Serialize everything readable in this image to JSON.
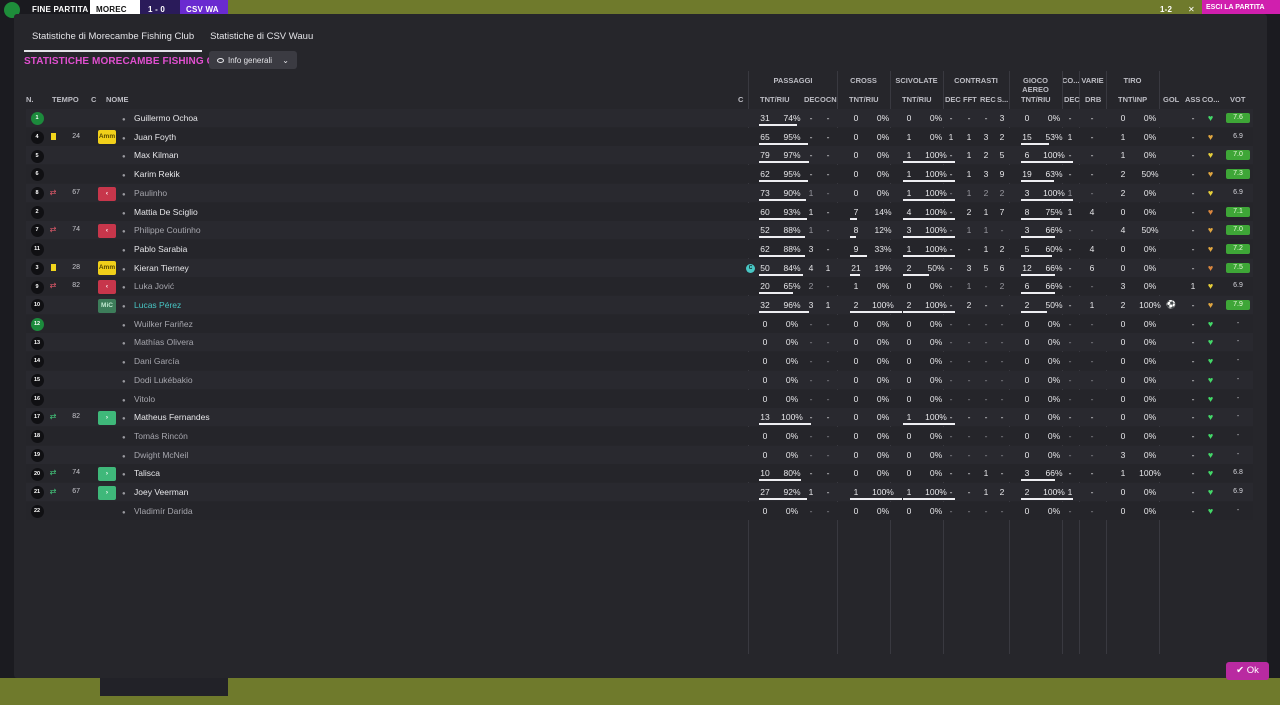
{
  "header_bar": {
    "labels": [
      "FINE PARTITA",
      "MOREC",
      "1 - 0",
      "CSV WA"
    ],
    "btn": "ESCI LA PARTITA",
    "score_mini": "1-2",
    "close_glyph": "✕"
  },
  "tabs": [
    {
      "label": "Statistiche di Morecambe Fishing Club",
      "active": true
    },
    {
      "label": "Statistiche di CSV Wauu",
      "active": false
    }
  ],
  "section_title": "STATISTICHE MORECAMBE FISHING CLUB",
  "dropdown_label": "Info generali",
  "group_headers": [
    "PASSAGGI",
    "CROSS",
    "SCIVOLATE",
    "CONTRASTI",
    "GIOCO AEREO",
    "CO...",
    "VARIE",
    "TIRO"
  ],
  "col_headers": {
    "num": "N.",
    "time": "TEMPO",
    "c": "C",
    "name": "NOME",
    "cap": "C",
    "pass_tnt": "TNT/RIU",
    "pass_dec": "DEC",
    "pass_ocn": "OCN",
    "cross_tnt": "TNT/RIU",
    "sciv_tnt": "TNT/RIU",
    "con_dec": "DEC",
    "con_fft": "FFT",
    "con_rec": "REC",
    "con_s": "S...",
    "aer_tnt": "TNT/RIU",
    "co_dec": "DEC",
    "drb": "DRB",
    "tiro": "TNT\\INP",
    "gol": "GOL",
    "ass": "ASS",
    "co2": "CO...",
    "vot": "VOT"
  },
  "ok_label": "Ok",
  "players": [
    {
      "n": "1",
      "gk": true,
      "ev": "",
      "min": "",
      "badge": "",
      "badge_type": "",
      "name": "Guillermo Ochoa",
      "style": "normal",
      "cap": false,
      "p": [
        "31",
        "74%"
      ],
      "p_bar": 0.74,
      "dec": "-",
      "ocn": "-",
      "cr": [
        "0",
        "0%"
      ],
      "cr_bar": 0,
      "sc": [
        "0",
        "0%"
      ],
      "sc_bar": 0,
      "ct": [
        "-",
        "-",
        "-",
        "3"
      ],
      "ae": [
        "0",
        "0%"
      ],
      "ae_bar": 0,
      "codec": "-",
      "drb": "-",
      "ti": [
        "0",
        "0%"
      ],
      "gol": "",
      "ass": "-",
      "heart": "#43d868",
      "vot": "7.6",
      "vot_g": true
    },
    {
      "n": "4",
      "gk": false,
      "ev": "yellow",
      "min": "24",
      "badge": "Amm",
      "badge_type": "amm",
      "name": "Juan Foyth",
      "style": "normal",
      "cap": false,
      "p": [
        "65",
        "95%"
      ],
      "p_bar": 0.95,
      "dec": "-",
      "ocn": "-",
      "cr": [
        "0",
        "0%"
      ],
      "cr_bar": 0,
      "sc": [
        "1",
        "0%"
      ],
      "sc_bar": 0,
      "ct": [
        "1",
        "1",
        "3",
        "2"
      ],
      "ae": [
        "15",
        "53%"
      ],
      "ae_bar": 0.53,
      "codec": "1",
      "drb": "-",
      "ti": [
        "1",
        "0%"
      ],
      "gol": "",
      "ass": "-",
      "heart": "#e0a640",
      "vot": "6.9",
      "vot_g": false
    },
    {
      "n": "5",
      "gk": false,
      "ev": "",
      "min": "",
      "badge": "",
      "badge_type": "",
      "name": "Max Kilman",
      "style": "normal",
      "cap": false,
      "p": [
        "79",
        "97%"
      ],
      "p_bar": 0.97,
      "dec": "-",
      "ocn": "-",
      "cr": [
        "0",
        "0%"
      ],
      "cr_bar": 0,
      "sc": [
        "1",
        "100%"
      ],
      "sc_bar": 1,
      "ct": [
        "-",
        "1",
        "2",
        "5"
      ],
      "ae": [
        "6",
        "100%"
      ],
      "ae_bar": 1,
      "codec": "-",
      "drb": "-",
      "ti": [
        "1",
        "0%"
      ],
      "gol": "",
      "ass": "-",
      "heart": "#e7cf3a",
      "vot": "7.0",
      "vot_g": true
    },
    {
      "n": "6",
      "gk": false,
      "ev": "",
      "min": "",
      "badge": "",
      "badge_type": "",
      "name": "Karim Rekik",
      "style": "normal",
      "cap": false,
      "p": [
        "62",
        "95%"
      ],
      "p_bar": 0.95,
      "dec": "-",
      "ocn": "-",
      "cr": [
        "0",
        "0%"
      ],
      "cr_bar": 0,
      "sc": [
        "1",
        "100%"
      ],
      "sc_bar": 1,
      "ct": [
        "-",
        "1",
        "3",
        "9"
      ],
      "ae": [
        "19",
        "63%"
      ],
      "ae_bar": 0.63,
      "codec": "-",
      "drb": "-",
      "ti": [
        "2",
        "50%"
      ],
      "gol": "",
      "ass": "-",
      "heart": "#e0a640",
      "vot": "7.3",
      "vot_g": true
    },
    {
      "n": "8",
      "gk": false,
      "ev": "out",
      "min": "67",
      "badge": "‹",
      "badge_type": "out",
      "name": "Paulinho",
      "style": "sub",
      "cap": false,
      "p": [
        "73",
        "90%"
      ],
      "p_bar": 0.9,
      "dec": "1",
      "ocn": "-",
      "cr": [
        "0",
        "0%"
      ],
      "cr_bar": 0,
      "sc": [
        "1",
        "100%"
      ],
      "sc_bar": 1,
      "ct": [
        "-",
        "1",
        "2",
        "2"
      ],
      "ae": [
        "3",
        "100%"
      ],
      "ae_bar": 1,
      "codec": "1",
      "drb": "-",
      "ti": [
        "2",
        "0%"
      ],
      "gol": "",
      "ass": "-",
      "heart": "#e7cf3a",
      "vot": "6.9",
      "vot_g": false
    },
    {
      "n": "2",
      "gk": false,
      "ev": "",
      "min": "",
      "badge": "",
      "badge_type": "",
      "name": "Mattia De Sciglio",
      "style": "normal",
      "cap": false,
      "p": [
        "60",
        "93%"
      ],
      "p_bar": 0.93,
      "dec": "1",
      "ocn": "-",
      "cr": [
        "7",
        "14%"
      ],
      "cr_bar": 0.14,
      "sc": [
        "4",
        "100%"
      ],
      "sc_bar": 1,
      "ct": [
        "-",
        "2",
        "1",
        "7"
      ],
      "ae": [
        "8",
        "75%"
      ],
      "ae_bar": 0.75,
      "codec": "1",
      "drb": "4",
      "ti": [
        "0",
        "0%"
      ],
      "gol": "",
      "ass": "-",
      "heart": "#d9863e",
      "vot": "7.1",
      "vot_g": true
    },
    {
      "n": "7",
      "gk": false,
      "ev": "out",
      "min": "74",
      "badge": "‹",
      "badge_type": "out",
      "name": "Philippe Coutinho",
      "style": "sub",
      "cap": false,
      "p": [
        "52",
        "88%"
      ],
      "p_bar": 0.88,
      "dec": "1",
      "ocn": "-",
      "cr": [
        "8",
        "12%"
      ],
      "cr_bar": 0.12,
      "sc": [
        "3",
        "100%"
      ],
      "sc_bar": 1,
      "ct": [
        "-",
        "1",
        "1",
        "-"
      ],
      "ae": [
        "3",
        "66%"
      ],
      "ae_bar": 0.66,
      "codec": "-",
      "drb": "-",
      "ti": [
        "4",
        "50%"
      ],
      "gol": "",
      "ass": "-",
      "heart": "#e0a640",
      "vot": "7.0",
      "vot_g": true
    },
    {
      "n": "11",
      "gk": false,
      "ev": "",
      "min": "",
      "badge": "",
      "badge_type": "",
      "name": "Pablo Sarabia",
      "style": "normal",
      "cap": false,
      "p": [
        "62",
        "88%"
      ],
      "p_bar": 0.88,
      "dec": "3",
      "ocn": "-",
      "cr": [
        "9",
        "33%"
      ],
      "cr_bar": 0.33,
      "sc": [
        "1",
        "100%"
      ],
      "sc_bar": 1,
      "ct": [
        "-",
        "-",
        "1",
        "2"
      ],
      "ae": [
        "5",
        "60%"
      ],
      "ae_bar": 0.6,
      "codec": "-",
      "drb": "4",
      "ti": [
        "0",
        "0%"
      ],
      "gol": "",
      "ass": "-",
      "heart": "#e0a640",
      "vot": "7.2",
      "vot_g": true
    },
    {
      "n": "3",
      "gk": false,
      "ev": "yellow",
      "min": "28",
      "badge": "Amm",
      "badge_type": "amm",
      "name": "Kieran Tierney",
      "style": "normal",
      "cap": true,
      "p": [
        "50",
        "84%"
      ],
      "p_bar": 0.84,
      "dec": "4",
      "ocn": "1",
      "cr": [
        "21",
        "19%"
      ],
      "cr_bar": 0.19,
      "sc": [
        "2",
        "50%"
      ],
      "sc_bar": 0.5,
      "ct": [
        "-",
        "3",
        "5",
        "6"
      ],
      "ae": [
        "12",
        "66%"
      ],
      "ae_bar": 0.66,
      "codec": "-",
      "drb": "6",
      "ti": [
        "0",
        "0%"
      ],
      "gol": "",
      "ass": "-",
      "heart": "#d9863e",
      "vot": "7.5",
      "vot_g": true
    },
    {
      "n": "9",
      "gk": false,
      "ev": "out",
      "min": "82",
      "badge": "‹",
      "badge_type": "out",
      "name": "Luka Jović",
      "style": "sub",
      "cap": false,
      "p": [
        "20",
        "65%"
      ],
      "p_bar": 0.65,
      "dec": "2",
      "ocn": "-",
      "cr": [
        "1",
        "0%"
      ],
      "cr_bar": 0,
      "sc": [
        "0",
        "0%"
      ],
      "sc_bar": 0,
      "ct": [
        "-",
        "1",
        "-",
        "2"
      ],
      "ae": [
        "6",
        "66%"
      ],
      "ae_bar": 0.66,
      "codec": "-",
      "drb": "-",
      "ti": [
        "3",
        "0%"
      ],
      "gol": "",
      "ass": "1",
      "heart": "#e7cf3a",
      "vot": "6.9",
      "vot_g": false
    },
    {
      "n": "10",
      "gk": false,
      "ev": "",
      "min": "",
      "badge": "MiC",
      "badge_type": "mic",
      "name": "Lucas Pérez",
      "style": "hl",
      "cap": false,
      "p": [
        "32",
        "96%"
      ],
      "p_bar": 0.96,
      "dec": "3",
      "ocn": "1",
      "cr": [
        "2",
        "100%"
      ],
      "cr_bar": 1,
      "sc": [
        "2",
        "100%"
      ],
      "sc_bar": 1,
      "ct": [
        "-",
        "2",
        "-",
        "-"
      ],
      "ae": [
        "2",
        "50%"
      ],
      "ae_bar": 0.5,
      "codec": "-",
      "drb": "1",
      "ti": [
        "2",
        "100%"
      ],
      "gol": "⚽",
      "ass": "-",
      "heart": "#e0a640",
      "vot": "7.9",
      "vot_g": true
    },
    {
      "n": "12",
      "gk": true,
      "ev": "",
      "min": "",
      "badge": "",
      "badge_type": "",
      "name": "Wuilker Fariñez",
      "style": "sub",
      "cap": false,
      "p": [
        "0",
        "0%"
      ],
      "p_bar": 0,
      "dec": "-",
      "ocn": "-",
      "cr": [
        "0",
        "0%"
      ],
      "cr_bar": 0,
      "sc": [
        "0",
        "0%"
      ],
      "sc_bar": 0,
      "ct": [
        "-",
        "-",
        "-",
        "-"
      ],
      "ae": [
        "0",
        "0%"
      ],
      "ae_bar": 0,
      "codec": "-",
      "drb": "-",
      "ti": [
        "0",
        "0%"
      ],
      "gol": "",
      "ass": "-",
      "heart": "#43d868",
      "vot": "-",
      "vot_g": false
    },
    {
      "n": "13",
      "gk": false,
      "ev": "",
      "min": "",
      "badge": "",
      "badge_type": "",
      "name": "Mathías Olivera",
      "style": "sub",
      "cap": false,
      "p": [
        "0",
        "0%"
      ],
      "p_bar": 0,
      "dec": "-",
      "ocn": "-",
      "cr": [
        "0",
        "0%"
      ],
      "cr_bar": 0,
      "sc": [
        "0",
        "0%"
      ],
      "sc_bar": 0,
      "ct": [
        "-",
        "-",
        "-",
        "-"
      ],
      "ae": [
        "0",
        "0%"
      ],
      "ae_bar": 0,
      "codec": "-",
      "drb": "-",
      "ti": [
        "0",
        "0%"
      ],
      "gol": "",
      "ass": "-",
      "heart": "#43d868",
      "vot": "-",
      "vot_g": false
    },
    {
      "n": "14",
      "gk": false,
      "ev": "",
      "min": "",
      "badge": "",
      "badge_type": "",
      "name": "Dani García",
      "style": "sub",
      "cap": false,
      "p": [
        "0",
        "0%"
      ],
      "p_bar": 0,
      "dec": "-",
      "ocn": "-",
      "cr": [
        "0",
        "0%"
      ],
      "cr_bar": 0,
      "sc": [
        "0",
        "0%"
      ],
      "sc_bar": 0,
      "ct": [
        "-",
        "-",
        "-",
        "-"
      ],
      "ae": [
        "0",
        "0%"
      ],
      "ae_bar": 0,
      "codec": "-",
      "drb": "-",
      "ti": [
        "0",
        "0%"
      ],
      "gol": "",
      "ass": "-",
      "heart": "#43d868",
      "vot": "-",
      "vot_g": false
    },
    {
      "n": "15",
      "gk": false,
      "ev": "",
      "min": "",
      "badge": "",
      "badge_type": "",
      "name": "Dodi Lukébakio",
      "style": "sub",
      "cap": false,
      "p": [
        "0",
        "0%"
      ],
      "p_bar": 0,
      "dec": "-",
      "ocn": "-",
      "cr": [
        "0",
        "0%"
      ],
      "cr_bar": 0,
      "sc": [
        "0",
        "0%"
      ],
      "sc_bar": 0,
      "ct": [
        "-",
        "-",
        "-",
        "-"
      ],
      "ae": [
        "0",
        "0%"
      ],
      "ae_bar": 0,
      "codec": "-",
      "drb": "-",
      "ti": [
        "0",
        "0%"
      ],
      "gol": "",
      "ass": "-",
      "heart": "#43d868",
      "vot": "-",
      "vot_g": false
    },
    {
      "n": "16",
      "gk": false,
      "ev": "",
      "min": "",
      "badge": "",
      "badge_type": "",
      "name": "Vitolo",
      "style": "sub",
      "cap": false,
      "p": [
        "0",
        "0%"
      ],
      "p_bar": 0,
      "dec": "-",
      "ocn": "-",
      "cr": [
        "0",
        "0%"
      ],
      "cr_bar": 0,
      "sc": [
        "0",
        "0%"
      ],
      "sc_bar": 0,
      "ct": [
        "-",
        "-",
        "-",
        "-"
      ],
      "ae": [
        "0",
        "0%"
      ],
      "ae_bar": 0,
      "codec": "-",
      "drb": "-",
      "ti": [
        "0",
        "0%"
      ],
      "gol": "",
      "ass": "-",
      "heart": "#43d868",
      "vot": "-",
      "vot_g": false
    },
    {
      "n": "17",
      "gk": false,
      "ev": "in",
      "min": "82",
      "badge": "›",
      "badge_type": "in",
      "name": "Matheus Fernandes",
      "style": "normal",
      "cap": false,
      "p": [
        "13",
        "100%"
      ],
      "p_bar": 1,
      "dec": "-",
      "ocn": "-",
      "cr": [
        "0",
        "0%"
      ],
      "cr_bar": 0,
      "sc": [
        "1",
        "100%"
      ],
      "sc_bar": 1,
      "ct": [
        "-",
        "-",
        "-",
        "-"
      ],
      "ae": [
        "0",
        "0%"
      ],
      "ae_bar": 0,
      "codec": "-",
      "drb": "-",
      "ti": [
        "0",
        "0%"
      ],
      "gol": "",
      "ass": "-",
      "heart": "#43d868",
      "vot": "-",
      "vot_g": false
    },
    {
      "n": "18",
      "gk": false,
      "ev": "",
      "min": "",
      "badge": "",
      "badge_type": "",
      "name": "Tomás Rincón",
      "style": "sub",
      "cap": false,
      "p": [
        "0",
        "0%"
      ],
      "p_bar": 0,
      "dec": "-",
      "ocn": "-",
      "cr": [
        "0",
        "0%"
      ],
      "cr_bar": 0,
      "sc": [
        "0",
        "0%"
      ],
      "sc_bar": 0,
      "ct": [
        "-",
        "-",
        "-",
        "-"
      ],
      "ae": [
        "0",
        "0%"
      ],
      "ae_bar": 0,
      "codec": "-",
      "drb": "-",
      "ti": [
        "0",
        "0%"
      ],
      "gol": "",
      "ass": "-",
      "heart": "#43d868",
      "vot": "-",
      "vot_g": false
    },
    {
      "n": "19",
      "gk": false,
      "ev": "",
      "min": "",
      "badge": "",
      "badge_type": "",
      "name": "Dwight McNeil",
      "style": "sub",
      "cap": false,
      "p": [
        "0",
        "0%"
      ],
      "p_bar": 0,
      "dec": "-",
      "ocn": "-",
      "cr": [
        "0",
        "0%"
      ],
      "cr_bar": 0,
      "sc": [
        "0",
        "0%"
      ],
      "sc_bar": 0,
      "ct": [
        "-",
        "-",
        "-",
        "-"
      ],
      "ae": [
        "0",
        "0%"
      ],
      "ae_bar": 0,
      "codec": "-",
      "drb": "-",
      "ti": [
        "3",
        "0%"
      ],
      "gol": "",
      "ass": "-",
      "heart": "#43d868",
      "vot": "-",
      "vot_g": false
    },
    {
      "n": "20",
      "gk": false,
      "ev": "in",
      "min": "74",
      "badge": "›",
      "badge_type": "in",
      "name": "Talisca",
      "style": "normal",
      "cap": false,
      "p": [
        "10",
        "80%"
      ],
      "p_bar": 0.8,
      "dec": "-",
      "ocn": "-",
      "cr": [
        "0",
        "0%"
      ],
      "cr_bar": 0,
      "sc": [
        "0",
        "0%"
      ],
      "sc_bar": 0,
      "ct": [
        "-",
        "-",
        "1",
        "-"
      ],
      "ae": [
        "3",
        "66%"
      ],
      "ae_bar": 0.66,
      "codec": "-",
      "drb": "-",
      "ti": [
        "1",
        "100%"
      ],
      "gol": "",
      "ass": "-",
      "heart": "#43d868",
      "vot": "6.8",
      "vot_g": false
    },
    {
      "n": "21",
      "gk": false,
      "ev": "in",
      "min": "67",
      "badge": "›",
      "badge_type": "in",
      "name": "Joey Veerman",
      "style": "normal",
      "cap": false,
      "p": [
        "27",
        "92%"
      ],
      "p_bar": 0.92,
      "dec": "1",
      "ocn": "-",
      "cr": [
        "1",
        "100%"
      ],
      "cr_bar": 1,
      "sc": [
        "1",
        "100%"
      ],
      "sc_bar": 1,
      "ct": [
        "-",
        "-",
        "1",
        "2"
      ],
      "ae": [
        "2",
        "100%"
      ],
      "ae_bar": 1,
      "codec": "1",
      "drb": "-",
      "ti": [
        "0",
        "0%"
      ],
      "gol": "",
      "ass": "-",
      "heart": "#43d868",
      "vot": "6.9",
      "vot_g": false
    },
    {
      "n": "22",
      "gk": false,
      "ev": "",
      "min": "",
      "badge": "",
      "badge_type": "",
      "name": "Vladimír Darida",
      "style": "sub",
      "cap": false,
      "p": [
        "0",
        "0%"
      ],
      "p_bar": 0,
      "dec": "-",
      "ocn": "-",
      "cr": [
        "0",
        "0%"
      ],
      "cr_bar": 0,
      "sc": [
        "0",
        "0%"
      ],
      "sc_bar": 0,
      "ct": [
        "-",
        "-",
        "-",
        "-"
      ],
      "ae": [
        "0",
        "0%"
      ],
      "ae_bar": 0,
      "codec": "-",
      "drb": "-",
      "ti": [
        "0",
        "0%"
      ],
      "gol": "",
      "ass": "-",
      "heart": "#43d868",
      "vot": "-",
      "vot_g": false
    }
  ]
}
